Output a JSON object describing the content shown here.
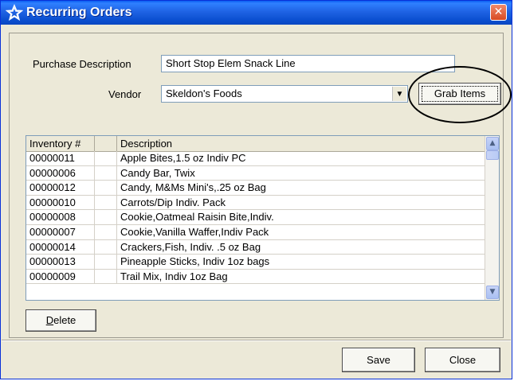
{
  "window": {
    "title": "Recurring Orders",
    "close_glyph": "✕",
    "accent": "#0a5ff0"
  },
  "form": {
    "purchase_description_label": "Purchase Description",
    "purchase_description_value": "Short Stop Elem Snack Line",
    "vendor_label": "Vendor",
    "vendor_value": "Skeldon's Foods",
    "grab_items_label": "Grab Items"
  },
  "grid": {
    "columns": [
      "Inventory #",
      "",
      "Description"
    ],
    "rows": [
      {
        "inventory": "00000011",
        "flag": "",
        "description": "Apple Bites,1.5 oz Indiv PC"
      },
      {
        "inventory": "00000006",
        "flag": "",
        "description": "Candy Bar, Twix"
      },
      {
        "inventory": "00000012",
        "flag": "",
        "description": "Candy, M&Ms Mini's,.25 oz Bag"
      },
      {
        "inventory": "00000010",
        "flag": "",
        "description": "Carrots/Dip Indiv. Pack"
      },
      {
        "inventory": "00000008",
        "flag": "",
        "description": "Cookie,Oatmeal Raisin Bite,Indiv."
      },
      {
        "inventory": "00000007",
        "flag": "",
        "description": "Cookie,Vanilla Waffer,Indiv Pack"
      },
      {
        "inventory": "00000014",
        "flag": "",
        "description": "Crackers,Fish, Indiv. .5 oz Bag"
      },
      {
        "inventory": "00000013",
        "flag": "",
        "description": "Pineapple Sticks, Indiv 1oz bags"
      },
      {
        "inventory": "00000009",
        "flag": "",
        "description": "Trail Mix, Indiv 1oz Bag"
      }
    ]
  },
  "buttons": {
    "delete_label_first": "D",
    "delete_label_rest": "elete",
    "save_label": "Save",
    "close_label": "Close"
  },
  "icons": {
    "title": "star-outline-icon",
    "close": "close-icon",
    "combo": "chevron-down-icon",
    "scroll_up": "chevron-up-icon",
    "scroll_down": "chevron-down-icon"
  }
}
